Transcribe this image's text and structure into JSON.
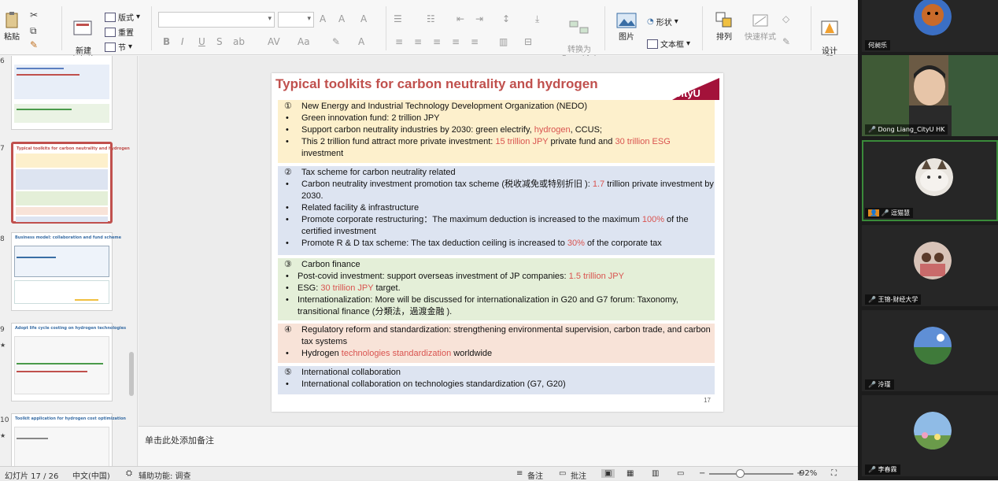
{
  "ribbon": {
    "paste": "粘贴",
    "new_slide": "新建\n幻灯片",
    "layout": "版式",
    "reset": "重置",
    "section": "节",
    "to_smartart": "转换为\nSmartArt",
    "picture": "图片",
    "shape": "形状",
    "textbox": "文本框",
    "arrange": "排列",
    "quick_styles": "快速样式",
    "design": "设计\n器"
  },
  "thumbnails": [
    {
      "number": "6",
      "title": ""
    },
    {
      "number": "7",
      "title": "Typical toolkits for carbon neutrality and hydrogen",
      "selected": true
    },
    {
      "number": "8",
      "title": "Business model: collaboration and fund scheme"
    },
    {
      "number": "9",
      "title": "Adopt life cycle costing on hydrogen technologies"
    },
    {
      "number": "10",
      "title": "Toolkit application for hydrogen cost optimization"
    }
  ],
  "slide": {
    "title": "Typical toolkits for carbon neutrality and hydrogen",
    "logo": "CityU",
    "page_number": "17",
    "sections": [
      {
        "num": "①",
        "head": "New Energy and Industrial Technology Development Organization (NEDO)",
        "color": "#fdf0cc",
        "bullets": [
          [
            {
              "t": "Green innovation fund: 2 trillion JPY"
            }
          ],
          [
            {
              "t": "Support carbon neutrality industries by 2030: green electrify, "
            },
            {
              "t": "hydrogen",
              "red": true
            },
            {
              "t": ", CCUS;"
            }
          ],
          [
            {
              "t": "This 2 trillion fund attract more private investment: "
            },
            {
              "t": "15 trillion JPY",
              "red": true
            },
            {
              "t": " private fund and "
            },
            {
              "t": "30 trillion ESG",
              "red": true
            },
            {
              "t": " investment"
            }
          ]
        ]
      },
      {
        "num": "②",
        "head": "Tax scheme for carbon neutrality related",
        "color": "#dde4f1",
        "bullets": [
          [
            {
              "t": "Carbon neutrality investment promotion tax scheme (税收减免或特别折旧 ): "
            },
            {
              "t": "1.7",
              "red": true
            },
            {
              "t": " trillion private investment by 2030."
            }
          ],
          [
            {
              "t": "Related facility & infrastructure"
            }
          ],
          [
            {
              "t": "Promote corporate restructuring：The maximum deduction is increased to the maximum "
            },
            {
              "t": "100%",
              "red": true
            },
            {
              "t": " of the certified investment"
            }
          ],
          [
            {
              "t": "Promote R & D tax scheme: The tax deduction ceiling is increased to "
            },
            {
              "t": "30%",
              "red": true
            },
            {
              "t": " of the corporate tax"
            }
          ]
        ]
      },
      {
        "num": "③",
        "head": "Carbon finance",
        "color": "#e4efd8",
        "bullets": [
          [
            {
              "t": "Post-covid investment: support overseas investment of JP companies: "
            },
            {
              "t": "1.5 trillion JPY",
              "red": true
            }
          ],
          [
            {
              "t": "ESG:  "
            },
            {
              "t": "30 trillion JPY",
              "red": true
            },
            {
              "t": " target."
            }
          ],
          [
            {
              "t": "Internationalization: More will be discussed for internationalization in G20 and G7 forum: Taxonomy, transitional finance (分類法，過渡金融 )."
            }
          ]
        ]
      },
      {
        "num": "④",
        "head": "Regulatory reform and standardization: strengthening environmental supervision, carbon trade, and carbon tax systems",
        "color": "#f8e3d8",
        "bullets": [
          [
            {
              "t": "Hydrogen "
            },
            {
              "t": "technologies standardization",
              "red": true
            },
            {
              "t": " worldwide"
            }
          ]
        ]
      },
      {
        "num": "⑤",
        "head": "International collaboration",
        "color": "#dde4f1",
        "bullets": [
          [
            {
              "t": "International collaboration on technologies standardization (G7, G20)"
            }
          ]
        ]
      }
    ]
  },
  "notes_placeholder": "单击此处添加备注",
  "status": {
    "slide_info": "幻灯片 17 / 26",
    "language": "中文(中国)",
    "accessibility": "辅助功能: 调查",
    "notes_btn": "备注",
    "comments_btn": "批注",
    "zoom": "92%"
  },
  "participants": [
    {
      "name": "何昶乐"
    },
    {
      "name": "Dong Liang_CityU HK",
      "active": false
    },
    {
      "name": "逗猫慧",
      "active": true
    },
    {
      "name": "王锦-财经大学"
    },
    {
      "name": "泠瑾"
    },
    {
      "name": "李春霖"
    }
  ]
}
